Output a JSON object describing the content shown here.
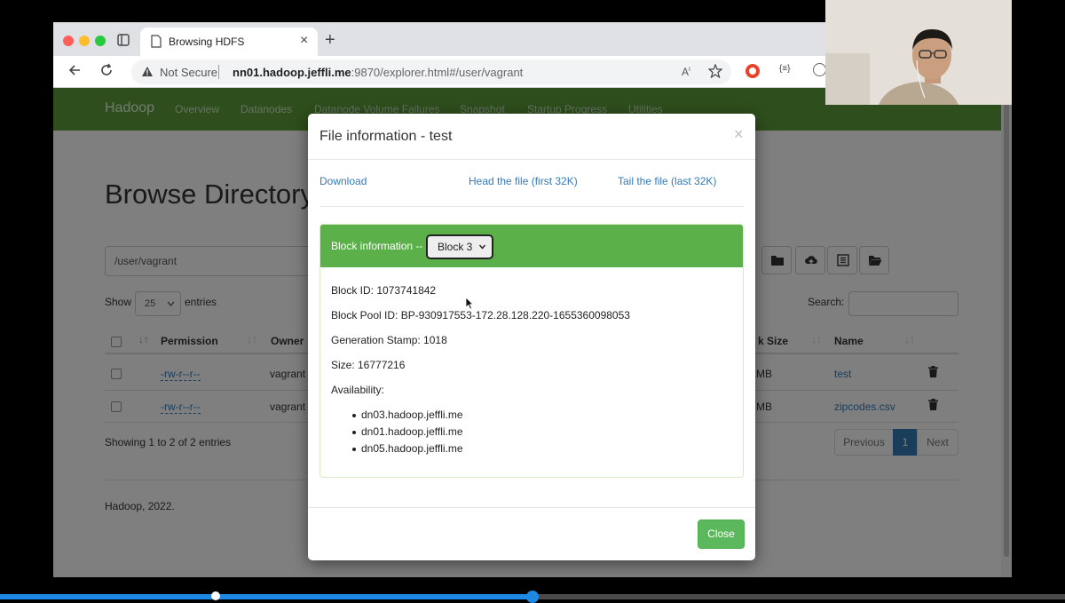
{
  "browser": {
    "tab_title": "Browsing HDFS",
    "security_label": "Not Secure",
    "url_host": "nn01.hadoop.jeffli.me",
    "url_rest": ":9870/explorer.html#/user/vagrant"
  },
  "navbar": {
    "brand": "Hadoop",
    "items": [
      "Overview",
      "Datanodes",
      "Datanode Volume Failures",
      "Snapshot",
      "Startup Progress",
      "Utilities"
    ]
  },
  "page": {
    "title": "Browse Directory",
    "path_value": "/user/vagrant",
    "show_label": "Show",
    "entries_value": "25",
    "entries_label": "entries",
    "search_label": "Search:",
    "columns": [
      "Permission",
      "Owner",
      "k Size",
      "Name"
    ],
    "rows": [
      {
        "permission": "-rw-r--r--",
        "owner": "vagrant",
        "size_suffix": "MB",
        "name": "test"
      },
      {
        "permission": "-rw-r--r--",
        "owner": "vagrant",
        "size_suffix": "MB",
        "name": "zipcodes.csv"
      }
    ],
    "showing_text": "Showing 1 to 2 of 2 entries",
    "pager": {
      "previous": "Previous",
      "current": "1",
      "next": "Next"
    },
    "footer": "Hadoop, 2022."
  },
  "modal": {
    "title": "File information - test",
    "close_symbol": "×",
    "links": {
      "download": "Download",
      "head": "Head the file (first 32K)",
      "tail": "Tail the file (last 32K)"
    },
    "block_label": "Block information --",
    "block_selected": "Block 3",
    "block_id": "Block ID: 1073741842",
    "block_pool_id": "Block Pool ID: BP-930917553-172.28.128.220-1655360098053",
    "generation_stamp": "Generation Stamp: 1018",
    "size": "Size: 16777216",
    "availability_label": "Availability:",
    "nodes": [
      "dn03.hadoop.jeffli.me",
      "dn01.hadoop.jeffli.me",
      "dn05.hadoop.jeffli.me"
    ],
    "close_button": "Close"
  },
  "video": {
    "progress_fraction": 0.5
  },
  "colors": {
    "navbar": "#5c9e3a",
    "panel_header": "#5cb04a",
    "close_button": "#5cb85c",
    "link": "#337ab7",
    "progress": "#1e88e5"
  }
}
